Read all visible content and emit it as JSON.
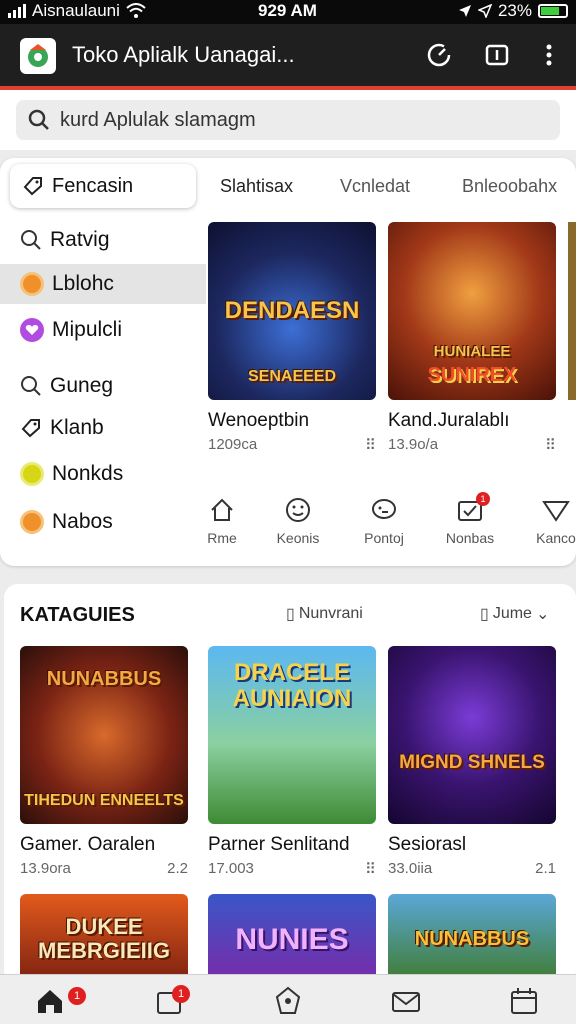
{
  "status": {
    "carrier": "Aisnaulauni",
    "time": "929 AM",
    "battery": "23%"
  },
  "browser": {
    "title": "Toko Aplialk Uanagai...",
    "colors": {
      "bar": "#1f1f1f",
      "accent": "#e04030"
    }
  },
  "search": {
    "placeholder": "kurd Aplulak slamagm"
  },
  "sidebar": {
    "pinned_label": "Fencasin",
    "items": [
      {
        "label": "Ratvig",
        "icon": "search-icon"
      },
      {
        "label": "Lblohc",
        "icon": "orange-dot"
      },
      {
        "label": "Mipulcli",
        "icon": "heart-icon"
      },
      {
        "label": "Guneg",
        "icon": "search-icon"
      },
      {
        "label": "Klanb",
        "icon": "tag-icon"
      },
      {
        "label": "Nonkds",
        "icon": "yellow-dot"
      },
      {
        "label": "Nabos",
        "icon": "orange-dot"
      }
    ]
  },
  "top_tabs": [
    "Slahtisax",
    "Vcnledat",
    "Bnleoobahx"
  ],
  "featured": [
    {
      "art_title": "DENDAESN",
      "art_sub": "SENAEEED",
      "name": "Wenoeptbin",
      "meta": "1209ca"
    },
    {
      "art_title": "HUNIALEE",
      "art_sub": "SUNIREX",
      "name": "Kand.Juralablı",
      "meta": "13.9o/a"
    }
  ],
  "quick_actions": [
    {
      "label": "Rme",
      "icon": "home-icon"
    },
    {
      "label": "Keonis",
      "icon": "smile-icon"
    },
    {
      "label": "Pontoj",
      "icon": "chat-icon"
    },
    {
      "label": "Nonbas",
      "icon": "check-icon",
      "badge": "1"
    },
    {
      "label": "Kanco",
      "icon": "triangle-icon"
    }
  ],
  "categories": {
    "heading": "KATAGUIES",
    "filter_a": "Nunvrani",
    "filter_b": "Jume"
  },
  "games_row1": [
    {
      "art_title": "NUNABBUS",
      "art_sub": "TIHEDUN ENNEELTS",
      "name": "Gamer. Oaralen",
      "meta": "13.9ora",
      "meta_right": "2.2"
    },
    {
      "art_title": "DRACELE AUNIAION",
      "art_sub": "",
      "name": "Parner Senlitand",
      "meta": "17.003",
      "meta_right": ""
    },
    {
      "art_title": "MIGND SHNELS",
      "art_sub": "",
      "name": "Sesiorasl",
      "meta": "33.0iia",
      "meta_right": "2.1"
    }
  ],
  "games_row2": [
    {
      "art_title": "DUKEE MEBRGIEIIG"
    },
    {
      "art_title": "NUNIES"
    },
    {
      "art_title": "NUNABBUS"
    }
  ],
  "bottom_nav": [
    {
      "icon": "home-icon",
      "badge": "1"
    },
    {
      "icon": "inbox-icon",
      "badge": "1"
    },
    {
      "icon": "compass-icon"
    },
    {
      "icon": "mail-icon"
    },
    {
      "icon": "calendar-icon"
    }
  ]
}
